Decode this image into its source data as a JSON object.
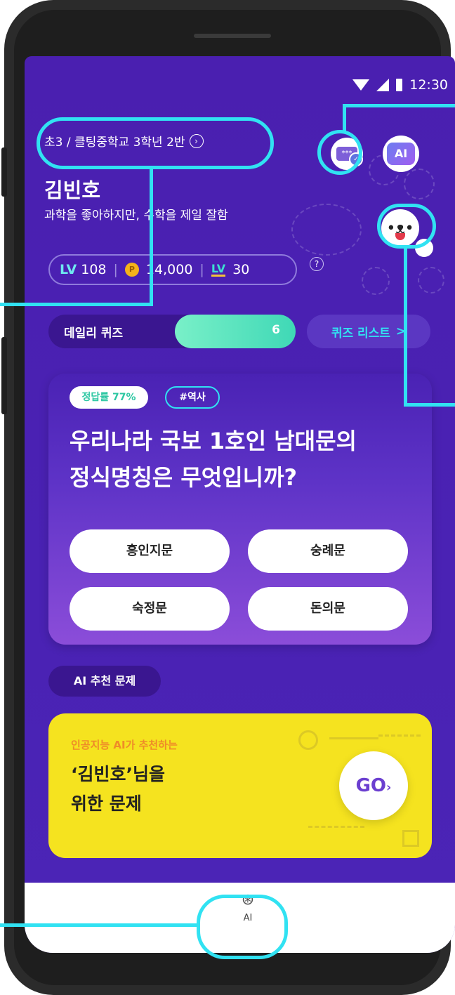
{
  "status_bar": {
    "time": "12:30"
  },
  "profile": {
    "school": "초3 / 클팅중학교 3학년 2반",
    "name": "김빈호",
    "bio": "과학을 좋아하지만, 수학을 제일 잘함"
  },
  "stats": {
    "level_prefix": "LV",
    "level": "108",
    "coin_icon": "P",
    "coins": "14,000",
    "tv_icon": "LV",
    "tv_count": "30",
    "help": "?"
  },
  "header_icons": {
    "card_icon_text": "***",
    "ai_icon_text": "AI"
  },
  "daily_quiz": {
    "label": "데일리 퀴즈",
    "count": "6",
    "list_label": "퀴즈 리스트",
    "list_arrow": ">"
  },
  "quiz": {
    "rate_label": "정답률 77%",
    "tag": "#역사",
    "question_line1": "우리나라 국보 1호인 남대문의",
    "question_line2": "정식명칭은 무엇입니까?",
    "answers": [
      "흥인지문",
      "숭례문",
      "숙정문",
      "돈의문"
    ]
  },
  "ai_recommend": {
    "section_label": "AI 추천 문제",
    "subtitle": "인공지능 AI가 추천하는",
    "title_line1": "‘김빈호’님을",
    "title_line2": "위한 문제",
    "go_label": "GO",
    "go_arrow": "›"
  },
  "bottom_nav": {
    "ai_label": "AI"
  },
  "colors": {
    "background_purple": "#4a1fb0",
    "highlight_cyan": "#31e2f2",
    "quiz_fill_teal": "#3fd8b6",
    "ai_card_yellow": "#f5e31f",
    "subtitle_orange": "#ef8b28"
  }
}
